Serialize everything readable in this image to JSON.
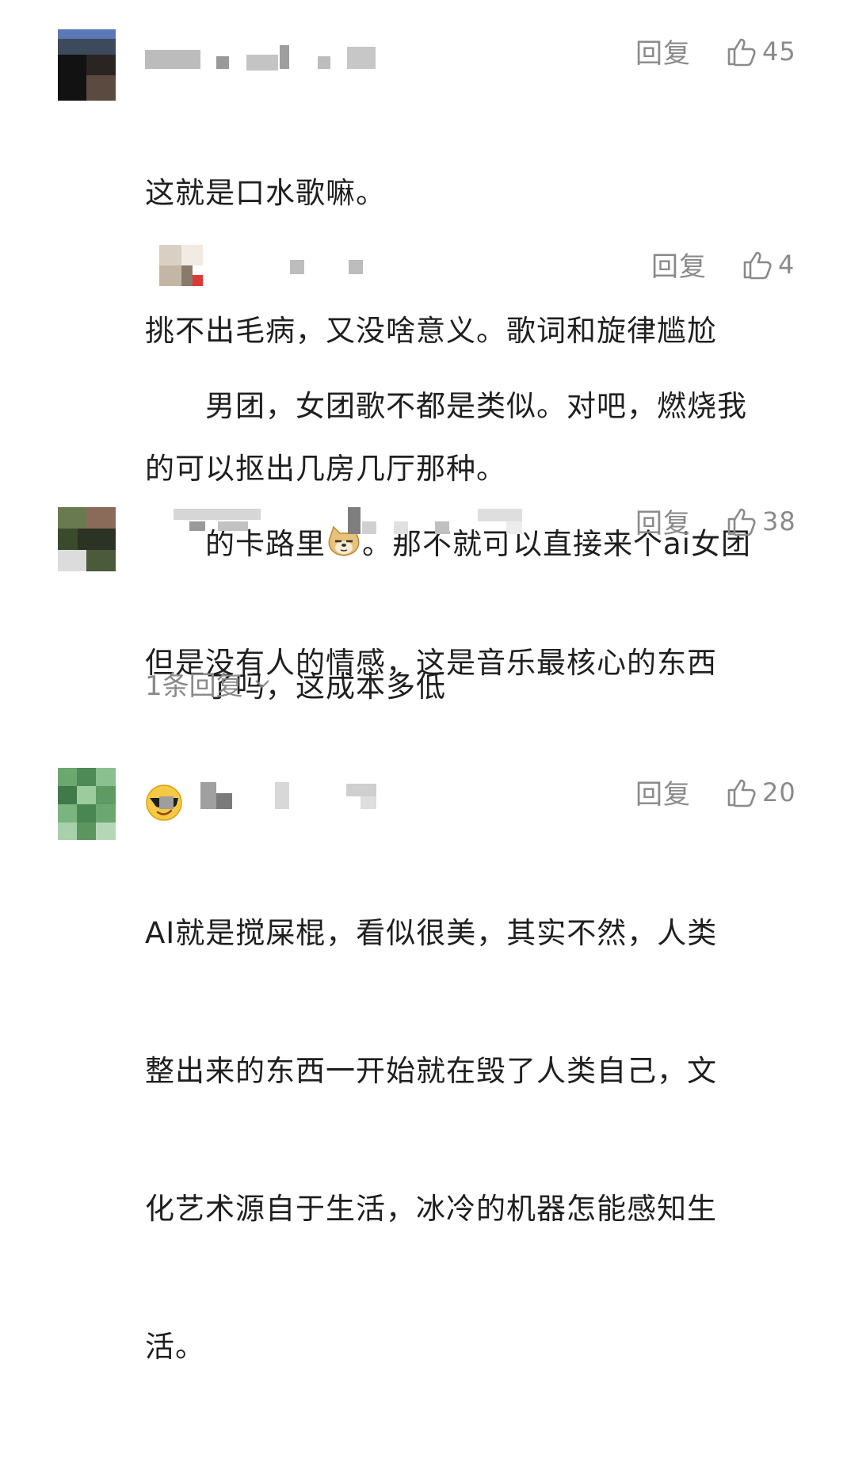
{
  "comments": [
    {
      "reply_label": "回复",
      "likes": "45",
      "lines": [
        "这就是口水歌嘛。",
        "挑不出毛病，又没啥意义。歌词和旋律尴尬",
        "的可以抠出几房几厅那种。"
      ],
      "avatar_icon": "pixelated-avatar-icon",
      "name_hidden": true
    },
    {
      "reply_label": "回复",
      "likes": "4",
      "lines": [
        "男团，女团歌不都是类似。对吧，燃烧我",
        "的卡路里",
        "。那不就可以直接来个ai女团",
        "了吗，这成本多低"
      ],
      "emoji": "doge-emoji-icon",
      "avatar_icon": "pixelated-avatar-icon",
      "name_hidden": true
    },
    {
      "reply_label": "回复",
      "likes": "38",
      "lines": [
        "但是没有人的情感，这是音乐最核心的东西"
      ],
      "emoji": "sunglasses-emoji-icon",
      "more_replies": "1条回复",
      "avatar_icon": "pixelated-avatar-icon",
      "name_hidden": true
    },
    {
      "reply_label": "回复",
      "likes": "20",
      "lines": [
        "AI就是搅屎棍，看似很美，其实不然，人类",
        "整出来的东西一开始就在毁了人类自己，文",
        "化艺术源自于生活，冰冷的机器怎能感知生",
        "活。"
      ],
      "avatar_icon": "pixelated-avatar-icon",
      "name_hidden": true
    }
  ],
  "colors": {
    "text": "#1f1f1f",
    "muted": "#8a8a8a",
    "background": "#ffffff"
  }
}
